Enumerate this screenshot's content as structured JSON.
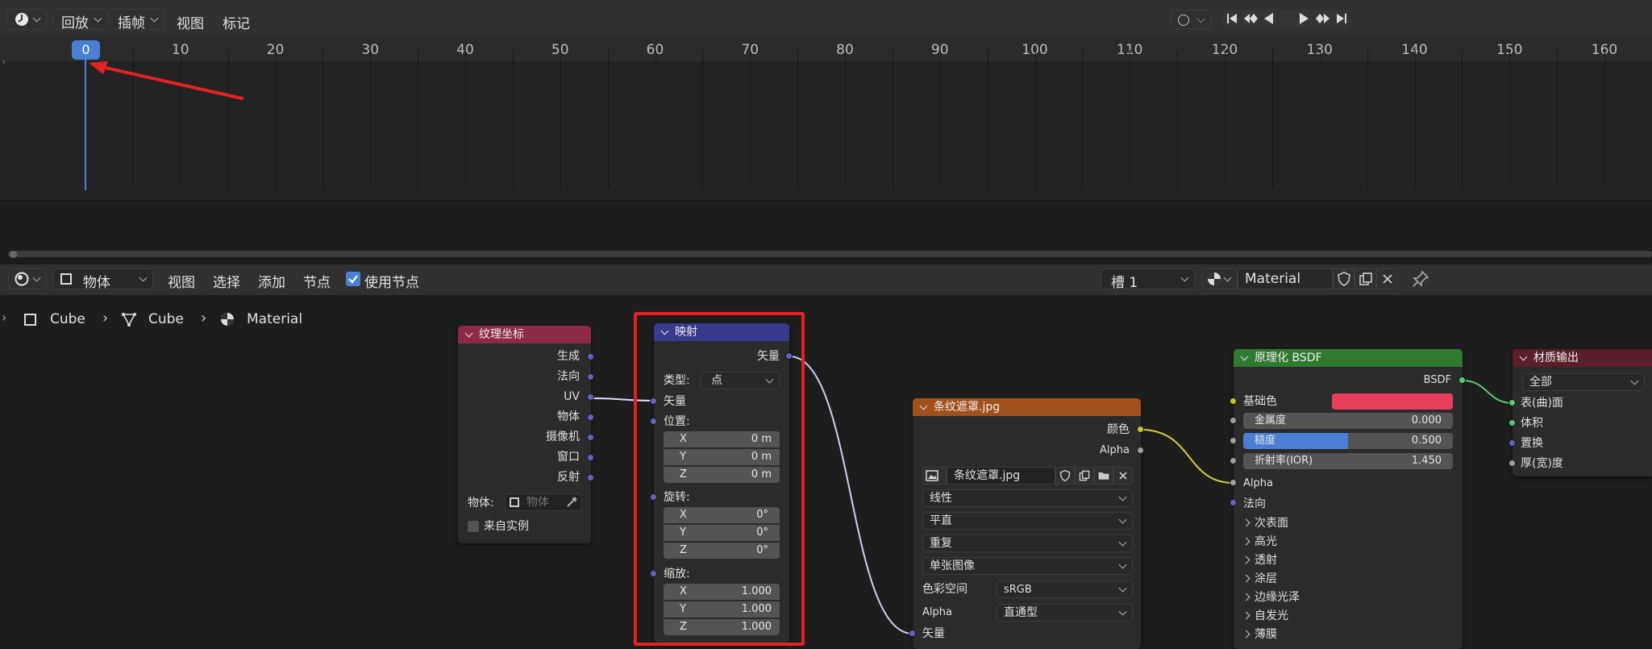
{
  "timeline": {
    "menu": [
      "回放",
      "插帧",
      "视图",
      "标记"
    ],
    "current_frame": "0",
    "ticks": [
      "10",
      "20",
      "30",
      "40",
      "50",
      "60",
      "70",
      "80",
      "90",
      "100",
      "110",
      "120",
      "130",
      "140",
      "150",
      "160"
    ]
  },
  "node_header": {
    "object_mode": "物体",
    "menu": [
      "视图",
      "选择",
      "添加",
      "节点"
    ],
    "use_nodes_label": "使用节点",
    "slot": "槽 1",
    "material_name": "Material"
  },
  "breadcrumb": [
    "Cube",
    "Cube",
    "Material"
  ],
  "nodes": {
    "texcoord": {
      "title": "纹理坐标",
      "outputs": [
        "生成",
        "法向",
        "UV",
        "物体",
        "摄像机",
        "窗口",
        "反射"
      ],
      "object_label": "物体:",
      "object_placeholder": "物体",
      "from_instancer": "来自实例"
    },
    "mapping": {
      "title": "映射",
      "output": "矢量",
      "type_label": "类型:",
      "type_value": "点",
      "vector_input": "矢量",
      "location_label": "位置:",
      "location": [
        {
          "axis": "X",
          "value": "0 m"
        },
        {
          "axis": "Y",
          "value": "0 m"
        },
        {
          "axis": "Z",
          "value": "0 m"
        }
      ],
      "rotation_label": "旋转:",
      "rotation": [
        {
          "axis": "X",
          "value": "0°"
        },
        {
          "axis": "Y",
          "value": "0°"
        },
        {
          "axis": "Z",
          "value": "0°"
        }
      ],
      "scale_label": "缩放:",
      "scale": [
        {
          "axis": "X",
          "value": "1.000"
        },
        {
          "axis": "Y",
          "value": "1.000"
        },
        {
          "axis": "Z",
          "value": "1.000"
        }
      ]
    },
    "image": {
      "title": "条纹遮罩.jpg",
      "outputs": [
        "颜色",
        "Alpha"
      ],
      "image_name": "条纹遮罩.jpg",
      "interpolation": "线性",
      "projection": "平直",
      "extension": "重复",
      "source": "单张图像",
      "colorspace_label": "色彩空间",
      "colorspace": "sRGB",
      "alpha_label": "Alpha",
      "alpha_mode": "直通型",
      "vector_input": "矢量"
    },
    "bsdf": {
      "title": "原理化 BSDF",
      "output": "BSDF",
      "base_color_label": "基础色",
      "base_color": "#e8405a",
      "metallic_label": "金属度",
      "metallic": "0.000",
      "metallic_level": 0.0,
      "roughness_label": "糙度",
      "roughness": "0.500",
      "roughness_level": 0.5,
      "ior_label": "折射率(IOR)",
      "ior": "1.450",
      "alpha_label": "Alpha",
      "normal_label": "法向",
      "panels": [
        "次表面",
        "高光",
        "透射",
        "涂层",
        "边缘光泽",
        "自发光",
        "薄膜"
      ]
    },
    "output": {
      "title": "材质输出",
      "target": "全部",
      "inputs": [
        "表(曲)面",
        "体积",
        "置换",
        "厚(宽)度"
      ]
    }
  },
  "colors": {
    "annotation_red": "#e52222",
    "shader_header": "#2e7a2e",
    "texture_header": "#a0501a",
    "vector_header": "#3a3a8c",
    "input_header": "#8c2a48",
    "output_header": "#5a1f28"
  }
}
